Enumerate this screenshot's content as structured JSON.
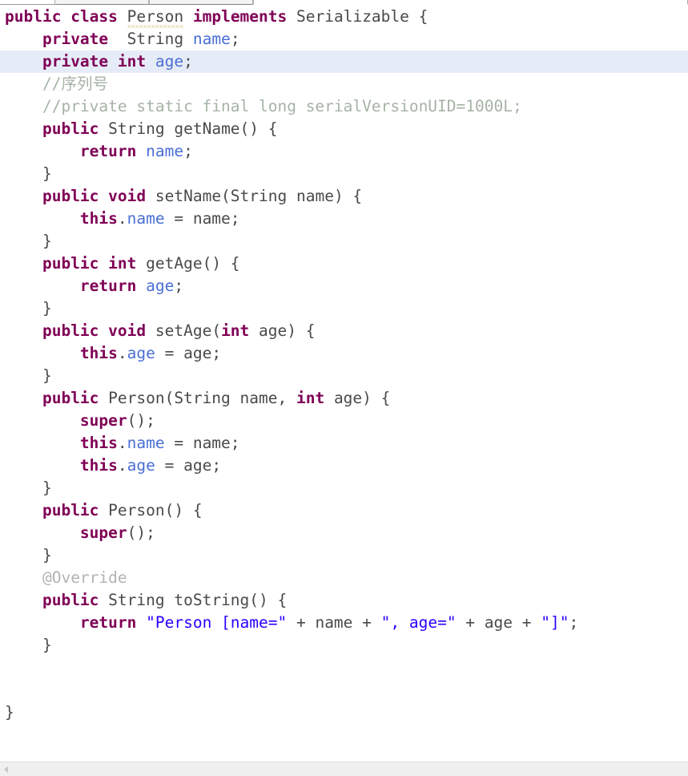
{
  "window": {
    "kind": "java-source-editor",
    "accent_color": "#7f0055",
    "field_color": "#4a6fd4",
    "string_color": "#2a00ff",
    "comment_color": "#a6b3a6",
    "highlight_row_color": "#e6ecf7",
    "warning_underline_color": "#c9ad42"
  },
  "tabs": [
    {
      "label": "",
      "active": false
    },
    {
      "label": "",
      "active": false
    },
    {
      "label": "",
      "active": true
    }
  ],
  "scrollbar": {
    "left_arrow": "scroll-left-icon",
    "right_arrow": "scroll-right-icon"
  },
  "editor": {
    "language": "Java",
    "class_name": "Person",
    "highlighted_line_number": 3,
    "lines": [
      {
        "n": 1,
        "indent": 0,
        "tokens": [
          {
            "t": "public",
            "c": "kw"
          },
          {
            "t": " ",
            "c": "pln"
          },
          {
            "t": "class",
            "c": "kw"
          },
          {
            "t": " ",
            "c": "pln"
          },
          {
            "t": "Person",
            "c": "pln warn"
          },
          {
            "t": " ",
            "c": "pln"
          },
          {
            "t": "implements",
            "c": "kw"
          },
          {
            "t": " ",
            "c": "pln"
          },
          {
            "t": "Serializable",
            "c": "pln"
          },
          {
            "t": " {",
            "c": "pln"
          }
        ]
      },
      {
        "n": 2,
        "indent": 1,
        "tokens": [
          {
            "t": "private",
            "c": "kw"
          },
          {
            "t": "  ",
            "c": "pln"
          },
          {
            "t": "String",
            "c": "pln"
          },
          {
            "t": " ",
            "c": "pln"
          },
          {
            "t": "name",
            "c": "fld"
          },
          {
            "t": ";",
            "c": "pln"
          }
        ]
      },
      {
        "n": 3,
        "indent": 1,
        "highlight": true,
        "tokens": [
          {
            "t": "private",
            "c": "kw"
          },
          {
            "t": " ",
            "c": "pln"
          },
          {
            "t": "int",
            "c": "kw"
          },
          {
            "t": " ",
            "c": "pln"
          },
          {
            "t": "age",
            "c": "fld"
          },
          {
            "t": ";",
            "c": "pln"
          }
        ]
      },
      {
        "n": 4,
        "indent": 1,
        "tokens": [
          {
            "t": "//序列号",
            "c": "cmt"
          }
        ]
      },
      {
        "n": 5,
        "indent": 1,
        "tokens": [
          {
            "t": "//private static final long serialVersionUID=1000L;",
            "c": "cmt"
          }
        ]
      },
      {
        "n": 6,
        "indent": 1,
        "tokens": [
          {
            "t": "public",
            "c": "kw"
          },
          {
            "t": " ",
            "c": "pln"
          },
          {
            "t": "String",
            "c": "pln"
          },
          {
            "t": " getName() {",
            "c": "pln"
          }
        ]
      },
      {
        "n": 7,
        "indent": 2,
        "tokens": [
          {
            "t": "return",
            "c": "kw"
          },
          {
            "t": " ",
            "c": "pln"
          },
          {
            "t": "name",
            "c": "fld"
          },
          {
            "t": ";",
            "c": "pln"
          }
        ]
      },
      {
        "n": 8,
        "indent": 1,
        "tokens": [
          {
            "t": "}",
            "c": "pln"
          }
        ]
      },
      {
        "n": 9,
        "indent": 1,
        "tokens": [
          {
            "t": "public",
            "c": "kw"
          },
          {
            "t": " ",
            "c": "pln"
          },
          {
            "t": "void",
            "c": "kw"
          },
          {
            "t": " setName(String name) {",
            "c": "pln"
          }
        ]
      },
      {
        "n": 10,
        "indent": 2,
        "tokens": [
          {
            "t": "this",
            "c": "kw"
          },
          {
            "t": ".",
            "c": "pln"
          },
          {
            "t": "name",
            "c": "fld"
          },
          {
            "t": " = name;",
            "c": "pln"
          }
        ]
      },
      {
        "n": 11,
        "indent": 1,
        "tokens": [
          {
            "t": "}",
            "c": "pln"
          }
        ]
      },
      {
        "n": 12,
        "indent": 1,
        "tokens": [
          {
            "t": "public",
            "c": "kw"
          },
          {
            "t": " ",
            "c": "pln"
          },
          {
            "t": "int",
            "c": "kw"
          },
          {
            "t": " getAge() {",
            "c": "pln"
          }
        ]
      },
      {
        "n": 13,
        "indent": 2,
        "tokens": [
          {
            "t": "return",
            "c": "kw"
          },
          {
            "t": " ",
            "c": "pln"
          },
          {
            "t": "age",
            "c": "fld"
          },
          {
            "t": ";",
            "c": "pln"
          }
        ]
      },
      {
        "n": 14,
        "indent": 1,
        "tokens": [
          {
            "t": "}",
            "c": "pln"
          }
        ]
      },
      {
        "n": 15,
        "indent": 1,
        "tokens": [
          {
            "t": "public",
            "c": "kw"
          },
          {
            "t": " ",
            "c": "pln"
          },
          {
            "t": "void",
            "c": "kw"
          },
          {
            "t": " setAge(",
            "c": "pln"
          },
          {
            "t": "int",
            "c": "kw"
          },
          {
            "t": " age) {",
            "c": "pln"
          }
        ]
      },
      {
        "n": 16,
        "indent": 2,
        "tokens": [
          {
            "t": "this",
            "c": "kw"
          },
          {
            "t": ".",
            "c": "pln"
          },
          {
            "t": "age",
            "c": "fld"
          },
          {
            "t": " = age;",
            "c": "pln"
          }
        ]
      },
      {
        "n": 17,
        "indent": 1,
        "tokens": [
          {
            "t": "}",
            "c": "pln"
          }
        ]
      },
      {
        "n": 18,
        "indent": 1,
        "tokens": [
          {
            "t": "public",
            "c": "kw"
          },
          {
            "t": " Person(String name, ",
            "c": "pln"
          },
          {
            "t": "int",
            "c": "kw"
          },
          {
            "t": " age) {",
            "c": "pln"
          }
        ]
      },
      {
        "n": 19,
        "indent": 2,
        "tokens": [
          {
            "t": "super",
            "c": "kw"
          },
          {
            "t": "();",
            "c": "pln"
          }
        ]
      },
      {
        "n": 20,
        "indent": 2,
        "tokens": [
          {
            "t": "this",
            "c": "kw"
          },
          {
            "t": ".",
            "c": "pln"
          },
          {
            "t": "name",
            "c": "fld"
          },
          {
            "t": " = name;",
            "c": "pln"
          }
        ]
      },
      {
        "n": 21,
        "indent": 2,
        "tokens": [
          {
            "t": "this",
            "c": "kw"
          },
          {
            "t": ".",
            "c": "pln"
          },
          {
            "t": "age",
            "c": "fld"
          },
          {
            "t": " = age;",
            "c": "pln"
          }
        ]
      },
      {
        "n": 22,
        "indent": 1,
        "tokens": [
          {
            "t": "}",
            "c": "pln"
          }
        ]
      },
      {
        "n": 23,
        "indent": 1,
        "tokens": [
          {
            "t": "public",
            "c": "kw"
          },
          {
            "t": " Person() {",
            "c": "pln"
          }
        ]
      },
      {
        "n": 24,
        "indent": 2,
        "tokens": [
          {
            "t": "super",
            "c": "kw"
          },
          {
            "t": "();",
            "c": "pln"
          }
        ]
      },
      {
        "n": 25,
        "indent": 1,
        "tokens": [
          {
            "t": "}",
            "c": "pln"
          }
        ]
      },
      {
        "n": 26,
        "indent": 1,
        "tokens": [
          {
            "t": "@Override",
            "c": "ann"
          }
        ]
      },
      {
        "n": 27,
        "indent": 1,
        "tokens": [
          {
            "t": "public",
            "c": "kw"
          },
          {
            "t": " ",
            "c": "pln"
          },
          {
            "t": "String",
            "c": "pln"
          },
          {
            "t": " toString() {",
            "c": "pln"
          }
        ]
      },
      {
        "n": 28,
        "indent": 2,
        "tokens": [
          {
            "t": "return",
            "c": "kw"
          },
          {
            "t": " ",
            "c": "pln"
          },
          {
            "t": "\"Person [name=\"",
            "c": "str"
          },
          {
            "t": " + name + ",
            "c": "pln"
          },
          {
            "t": "\", age=\"",
            "c": "str"
          },
          {
            "t": " + age + ",
            "c": "pln"
          },
          {
            "t": "\"]\"",
            "c": "str"
          },
          {
            "t": ";",
            "c": "pln"
          }
        ]
      },
      {
        "n": 29,
        "indent": 1,
        "tokens": [
          {
            "t": "}",
            "c": "pln"
          }
        ]
      },
      {
        "n": 30,
        "indent": 0,
        "tokens": []
      },
      {
        "n": 31,
        "indent": 0,
        "tokens": []
      },
      {
        "n": 32,
        "indent": 0,
        "tokens": [
          {
            "t": "}",
            "c": "pln"
          }
        ]
      }
    ],
    "fold_marker_lines": [
      6,
      9,
      12,
      15,
      18,
      23,
      27
    ]
  }
}
